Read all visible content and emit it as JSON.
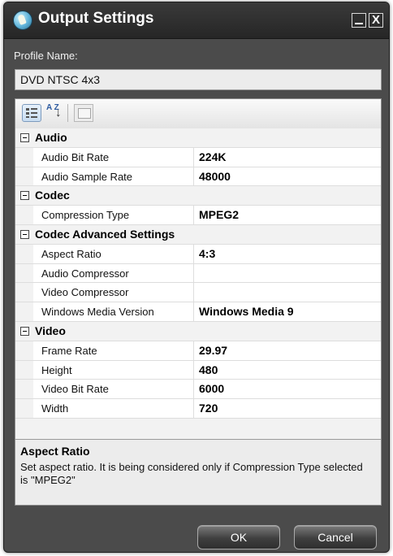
{
  "window": {
    "title": "Output Settings",
    "close_glyph": "X"
  },
  "profile": {
    "label": "Profile Name:",
    "value": "DVD NTSC 4x3"
  },
  "toolbar": {
    "categorized_icon": "categorized-icon",
    "alphabetical_icon": "az-sort-icon",
    "property_pages_icon": "property-pages-icon",
    "az_text": "A Z",
    "arrow_glyph": "↓"
  },
  "categories": [
    {
      "label": "Audio",
      "properties": [
        {
          "name": "Audio Bit Rate",
          "value": "224K"
        },
        {
          "name": "Audio Sample Rate",
          "value": "48000"
        }
      ]
    },
    {
      "label": "Codec",
      "properties": [
        {
          "name": "Compression Type",
          "value": "MPEG2"
        }
      ]
    },
    {
      "label": "Codec Advanced Settings",
      "properties": [
        {
          "name": "Aspect Ratio",
          "value": "4:3"
        },
        {
          "name": "Audio Compressor",
          "value": ""
        },
        {
          "name": "Video Compressor",
          "value": ""
        },
        {
          "name": "Windows Media Version",
          "value": "Windows Media 9"
        }
      ]
    },
    {
      "label": "Video",
      "properties": [
        {
          "name": "Frame Rate",
          "value": "29.97"
        },
        {
          "name": "Height",
          "value": "480"
        },
        {
          "name": "Video Bit Rate",
          "value": "6000"
        },
        {
          "name": "Width",
          "value": "720"
        }
      ]
    }
  ],
  "description": {
    "title": "Aspect Ratio",
    "text": "Set aspect ratio. It is being considered only if Compression Type selected is \"MPEG2\""
  },
  "buttons": {
    "ok": "OK",
    "cancel": "Cancel"
  }
}
